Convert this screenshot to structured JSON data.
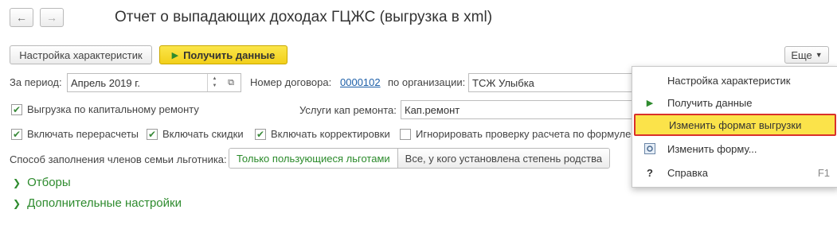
{
  "nav": {
    "back_icon": "left-arrow-icon",
    "forward_icon": "right-arrow-icon"
  },
  "page_title": "Отчет о выпадающих доходах ГЦЖС (выгрузка в xml)",
  "toolbar": {
    "settings_label": "Настройка характеристик",
    "get_data_label": "Получить данные",
    "more_label": "Еще"
  },
  "form": {
    "period_label": "За период:",
    "period_value": "Апрель 2019 г.",
    "contract_label": "Номер договора:",
    "contract_value": "0000102",
    "org_label": "по организации:",
    "org_value": "ТСЖ Улыбка",
    "capital_repair_label": "Выгрузка по капитальному ремонту",
    "services_label": "Услуги кап ремонта:",
    "services_value": "Кап.ремонт",
    "recalc_label": "Включать перерасчеты",
    "discounts_label": "Включать скидки",
    "corrections_label": "Включать корректировки",
    "ignore_label": "Игнорировать проверку расчета по формуле",
    "family_fill_label": "Способ заполнения членов семьи льготника:",
    "family_option_1": "Только пользующиеся льготами",
    "family_option_2": "Все, у кого установлена степень родства"
  },
  "groups": {
    "filters": "Отборы",
    "additional": "Дополнительные настройки"
  },
  "menu": {
    "items": [
      {
        "label": "Настройка характеристик",
        "shortcut": ""
      },
      {
        "label": "Получить данные",
        "shortcut": ""
      },
      {
        "label": "Изменить формат выгрузки",
        "shortcut": ""
      },
      {
        "label": "Изменить форму...",
        "shortcut": ""
      },
      {
        "label": "Справка",
        "shortcut": "F1"
      }
    ]
  },
  "colors": {
    "accent_green": "#2e8b2e",
    "primary_yellow": "#f6d82a",
    "highlight_border": "#d9312b"
  }
}
